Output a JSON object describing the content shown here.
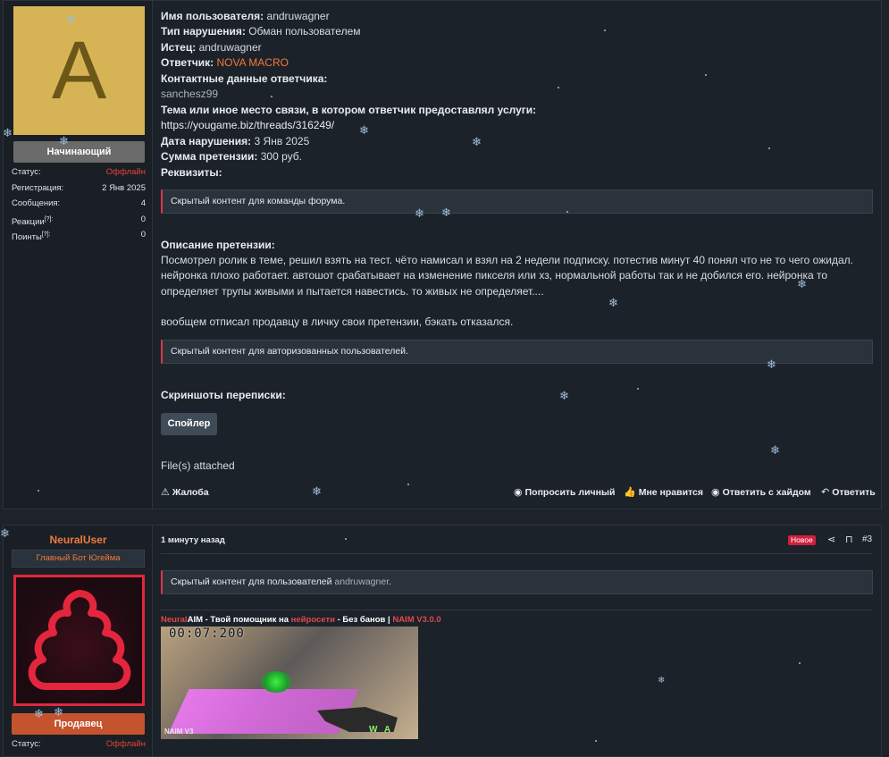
{
  "post1": {
    "avatar_letter": "A",
    "rank": "Начинающий",
    "stats": [
      {
        "label": "Статус:",
        "value": "Оффлайн"
      },
      {
        "label": "Регистрация:",
        "value": "2 Янв 2025"
      },
      {
        "label": "Сообщения:",
        "value": "4"
      },
      {
        "label": "Реакции",
        "value": "0"
      },
      {
        "label": "Поинты",
        "value": "0"
      }
    ],
    "stat_suffix": "[?]:",
    "fields": {
      "username_label": "Имя пользователя:",
      "username_value": "andruwagner",
      "violation_label": "Тип нарушения:",
      "violation_value": "Обман пользователем",
      "plaintiff_label": "Истец:",
      "plaintiff_value": "andruwagner",
      "defendant_label": "Ответчик:",
      "defendant_value": "NOVA MACRO",
      "contacts_label": "Контактные данные ответчика:",
      "contacts_value": "sanchesz99",
      "topic_label": "Тема или иное место связи, в котором ответчик предоставлял услуги:",
      "topic_value": "https://yougame.biz/threads/316249/",
      "date_label": "Дата нарушения:",
      "date_value": "3 Янв 2025",
      "amount_label": "Сумма претензии:",
      "amount_value": "300 руб.",
      "details_label": "Реквизиты:"
    },
    "hidden_team": "Скрытый контент для команды форума.",
    "description_label": "Описание претензии:",
    "description_text": "Посмотрел ролик в теме, решил взять на тест. чёто намисал и взял на 2 недели подписку. потестив минут 40 понял что не то чего ожидал. нейронка плохо работает. автошот срабатывает на изменение пикселя или хз, нормальной работы так и не добился его. нейронка то определяет трупы живыми и пытается навестись. то живых не определяет....",
    "description_text2": "вообщем отписал продавцу в личку свои претензии, бэкать отказался.",
    "hidden_auth": "Скрытый контент для авторизованных пользователей.",
    "screenshots_label": "Скриншоты переписки:",
    "spoiler_button": "Спойлер",
    "files_attached": "File(s) attached",
    "actions": {
      "report": "Жалоба",
      "ask_private": "Попросить личный",
      "like": "Мне нравится",
      "reply_hide": "Ответить с хайдом",
      "reply": "Ответить"
    }
  },
  "post2": {
    "username": "NeuralUser",
    "user_title": "Главный Бот Югейма",
    "rank": "Продавец",
    "status_label": "Статус:",
    "status_value": "Оффлайн",
    "time": "1 минуту назад",
    "new_badge": "Новое",
    "post_number": "#3",
    "hidden_prefix": "Скрытый контент для пользователей",
    "hidden_user": "andruwagner",
    "hidden_suffix": ".",
    "brand": {
      "neural": "Neural",
      "aim_text": "AIM - Твой помощник на ",
      "neuro": "нейросети",
      "nobans": " - Без банов | ",
      "version": "NAIM V3.0.0"
    },
    "video": {
      "timer": "00:07:200",
      "overlay_label": "NAIM V3",
      "keys": "WA"
    }
  },
  "colors": {
    "accent_orange": "#f07a3c",
    "offline_red": "#e0433a",
    "hidden_border": "#d43a4b",
    "new_badge": "#d21f3c"
  }
}
